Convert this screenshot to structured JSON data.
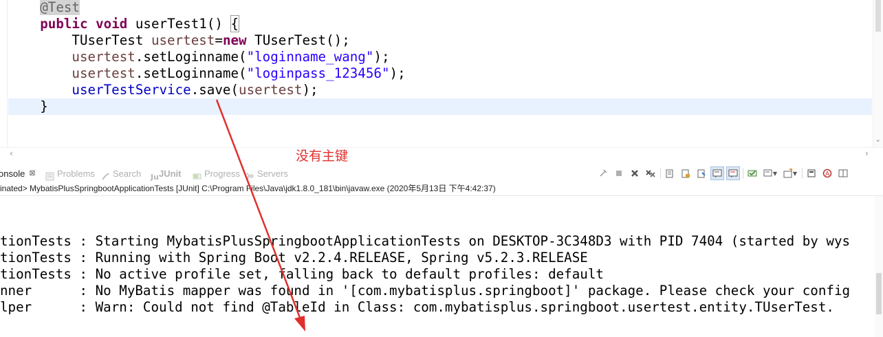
{
  "editor": {
    "lines": [
      {
        "indent": "    ",
        "parts": [
          {
            "t": "@Test",
            "c": "ann"
          }
        ]
      },
      {
        "indent": "    ",
        "parts": [
          {
            "t": "public",
            "c": "kw"
          },
          {
            "t": " "
          },
          {
            "t": "void",
            "c": "kw"
          },
          {
            "t": " userTest1() "
          },
          {
            "t": "{",
            "c": "brace-box"
          }
        ]
      },
      {
        "indent": "        ",
        "parts": [
          {
            "t": "TUserTest "
          },
          {
            "t": "usertest",
            "c": "local"
          },
          {
            "t": "="
          },
          {
            "t": "new",
            "c": "kw"
          },
          {
            "t": " TUserTest();"
          }
        ]
      },
      {
        "indent": "        ",
        "parts": [
          {
            "t": "usertest",
            "c": "local"
          },
          {
            "t": ".setLoginname("
          },
          {
            "t": "\"loginname_wang\"",
            "c": "str"
          },
          {
            "t": ");"
          }
        ]
      },
      {
        "indent": "        ",
        "parts": [
          {
            "t": "usertest",
            "c": "local"
          },
          {
            "t": ".setLoginname("
          },
          {
            "t": "\"loginpass_123456\"",
            "c": "str"
          },
          {
            "t": ");"
          }
        ]
      },
      {
        "indent": "        ",
        "parts": [
          {
            "t": "userTestService",
            "c": "field"
          },
          {
            "t": ".save("
          },
          {
            "t": "usertest",
            "c": "local"
          },
          {
            "t": ");"
          }
        ]
      },
      {
        "indent": "    ",
        "parts": [
          {
            "t": "}"
          }
        ],
        "current": true
      }
    ],
    "annotation_text": "没有主键",
    "annotation_color": "#e0302e"
  },
  "tabs": [
    {
      "label": "onsole",
      "active": true,
      "icon": "console-icon"
    },
    {
      "label": "Problems",
      "icon": "problems-icon"
    },
    {
      "label": "Search",
      "icon": "search-icon"
    },
    {
      "label": "JUnit",
      "icon": "junit-icon",
      "bold": true
    },
    {
      "label": "Progress",
      "icon": "progress-icon"
    },
    {
      "label": "Servers",
      "icon": "servers-icon"
    }
  ],
  "status": {
    "text": "inated> MybatisPlusSpringbootApplicationTests [JUnit] C:\\Program Files\\Java\\jdk1.8.0_181\\bin\\javaw.exe (2020年5月13日 下午4:42:37)"
  },
  "console": {
    "lines": [
      "tionTests : Starting MybatisPlusSpringbootApplicationTests on DESKTOP-3C348D3 with PID 7404 (started by wys",
      "tionTests : Running with Spring Boot v2.2.4.RELEASE, Spring v5.2.3.RELEASE",
      "tionTests : No active profile set, falling back to default profiles: default",
      "nner      : No MyBatis mapper was found in '[com.mybatisplus.springboot]' package. Please check your config",
      "lper      : Warn: Could not find @TableId in Class: com.mybatisplus.springboot.usertest.entity.TUserTest."
    ]
  },
  "toolbar_icons": [
    "pin-console-icon",
    "terminate-icon",
    "remove-launch-icon",
    "remove-all-terminated-icon",
    "clear-console-icon",
    "scroll-lock-icon",
    "word-wrap-icon",
    "show-on-stdout-icon",
    "show-on-stderr-icon",
    "display-selected-console-icon",
    "open-console-icon",
    "new-console-icon",
    "minimize-icon",
    "maximize-icon"
  ]
}
